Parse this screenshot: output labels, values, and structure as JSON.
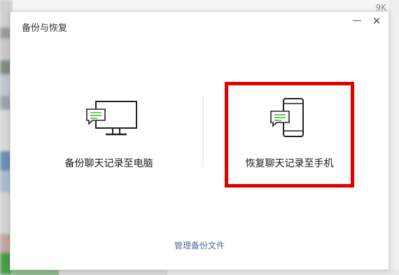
{
  "background": {
    "badge": "9K"
  },
  "dialog": {
    "title": "备份与恢复",
    "minimize_glyph": "—",
    "close_glyph": "✕",
    "options": [
      {
        "label": "备份聊天记录至电脑",
        "icon": "monitor-chat-icon"
      },
      {
        "label": "恢复聊天记录至手机",
        "icon": "phone-chat-icon"
      }
    ],
    "manage_link": "管理备份文件"
  },
  "colors": {
    "highlight_border": "#e00000",
    "link": "#576b95",
    "bubble_green": "#5aaf4a",
    "icon_stroke": "#222222"
  }
}
